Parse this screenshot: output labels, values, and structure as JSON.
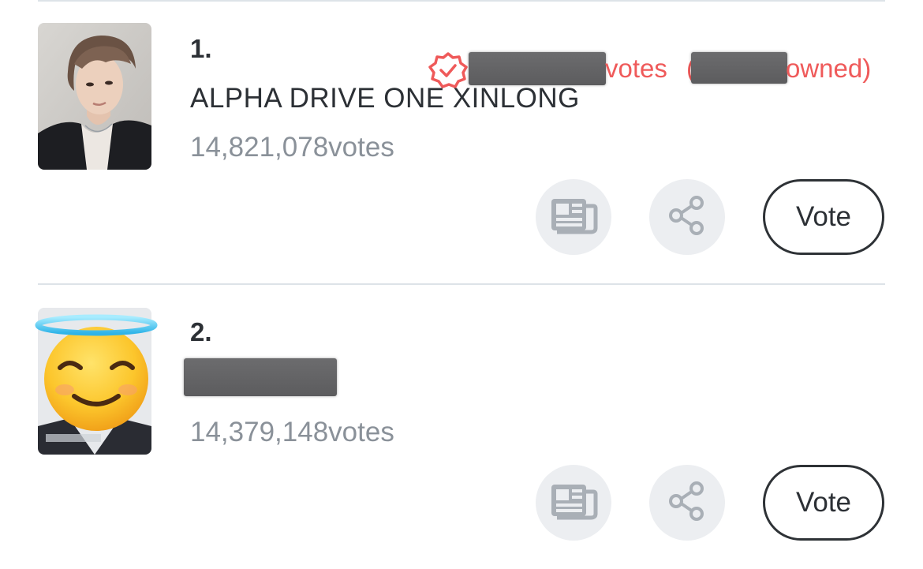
{
  "entries": [
    {
      "rank": "1.",
      "name": "ALPHA DRIVE ONE XINLONG",
      "votes": "14,821,078votes",
      "owned_votes_label": "votes",
      "owned_open": "(",
      "owned_label": "owned)",
      "vote_label": "Vote"
    },
    {
      "rank": "2.",
      "name": "",
      "votes": "14,379,148votes",
      "vote_label": "Vote"
    }
  ],
  "icons": {
    "verified": "verified-badge-icon",
    "news": "newspaper-icon",
    "share": "share-icon",
    "emoji": "smiling-face-with-halo-emoji"
  },
  "colors": {
    "accent_red": "#ef5a5a",
    "muted_text": "#8a9199",
    "button_bg": "#eceef1"
  }
}
